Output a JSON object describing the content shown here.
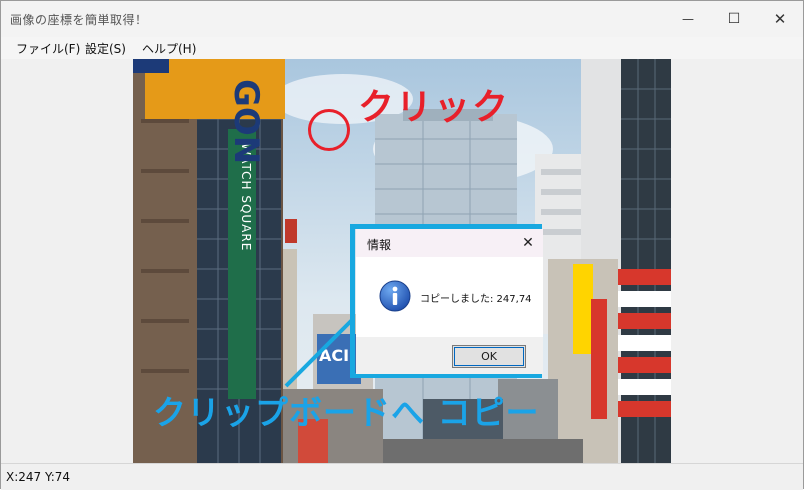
{
  "window": {
    "title": "画像の座標を簡単取得！",
    "controls": {
      "minimize": "—",
      "maximize": "☐",
      "close": "✕"
    }
  },
  "menubar": {
    "items": [
      {
        "label": "ファイル(F)"
      },
      {
        "label": "設定(S)"
      },
      {
        "label": "ヘルプ(H)"
      }
    ]
  },
  "photo": {
    "signs": {
      "building_sign": "WATCH SQUARE",
      "top_sign": "GON",
      "billboard": "ACI"
    }
  },
  "annotations": {
    "click_label": "クリック",
    "clipboard_label": "クリップボードへ コピー"
  },
  "dialog": {
    "title": "情報",
    "message": "コピーしました: 247,74",
    "ok_label": "OK",
    "close_glyph": "✕"
  },
  "statusbar": {
    "coords": "X:247 Y:74"
  },
  "colors": {
    "annotation_red": "#e8202a",
    "annotation_blue": "#18a8e0",
    "info_icon": "#1f5fc4"
  }
}
